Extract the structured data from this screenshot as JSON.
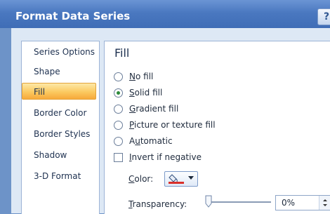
{
  "dialog": {
    "title": "Format Data Series",
    "help_label": "?"
  },
  "nav": {
    "items": [
      {
        "label": "Series Options",
        "selected": false
      },
      {
        "label": "Shape",
        "selected": false
      },
      {
        "label": "Fill",
        "selected": true
      },
      {
        "label": "Border Color",
        "selected": false
      },
      {
        "label": "Border Styles",
        "selected": false
      },
      {
        "label": "Shadow",
        "selected": false
      },
      {
        "label": "3-D Format",
        "selected": false
      }
    ]
  },
  "fill": {
    "section_title": "Fill",
    "options": [
      {
        "key": "N",
        "rest": "o fill",
        "checked": false
      },
      {
        "key": "S",
        "rest": "olid fill",
        "checked": true
      },
      {
        "key": "G",
        "rest": "radient fill",
        "checked": false
      },
      {
        "key": "P",
        "rest": "icture or texture fill",
        "checked": false
      },
      {
        "pre": "A",
        "key": "u",
        "rest": "tomatic",
        "checked": false
      }
    ],
    "invert": {
      "key": "I",
      "rest": "nvert if negative",
      "checked": false
    },
    "color": {
      "key": "C",
      "rest": "olor:",
      "value": "#d9302a"
    },
    "transparency": {
      "key": "T",
      "rest": "ransparency:",
      "value_text": "0%",
      "value": 0
    }
  }
}
